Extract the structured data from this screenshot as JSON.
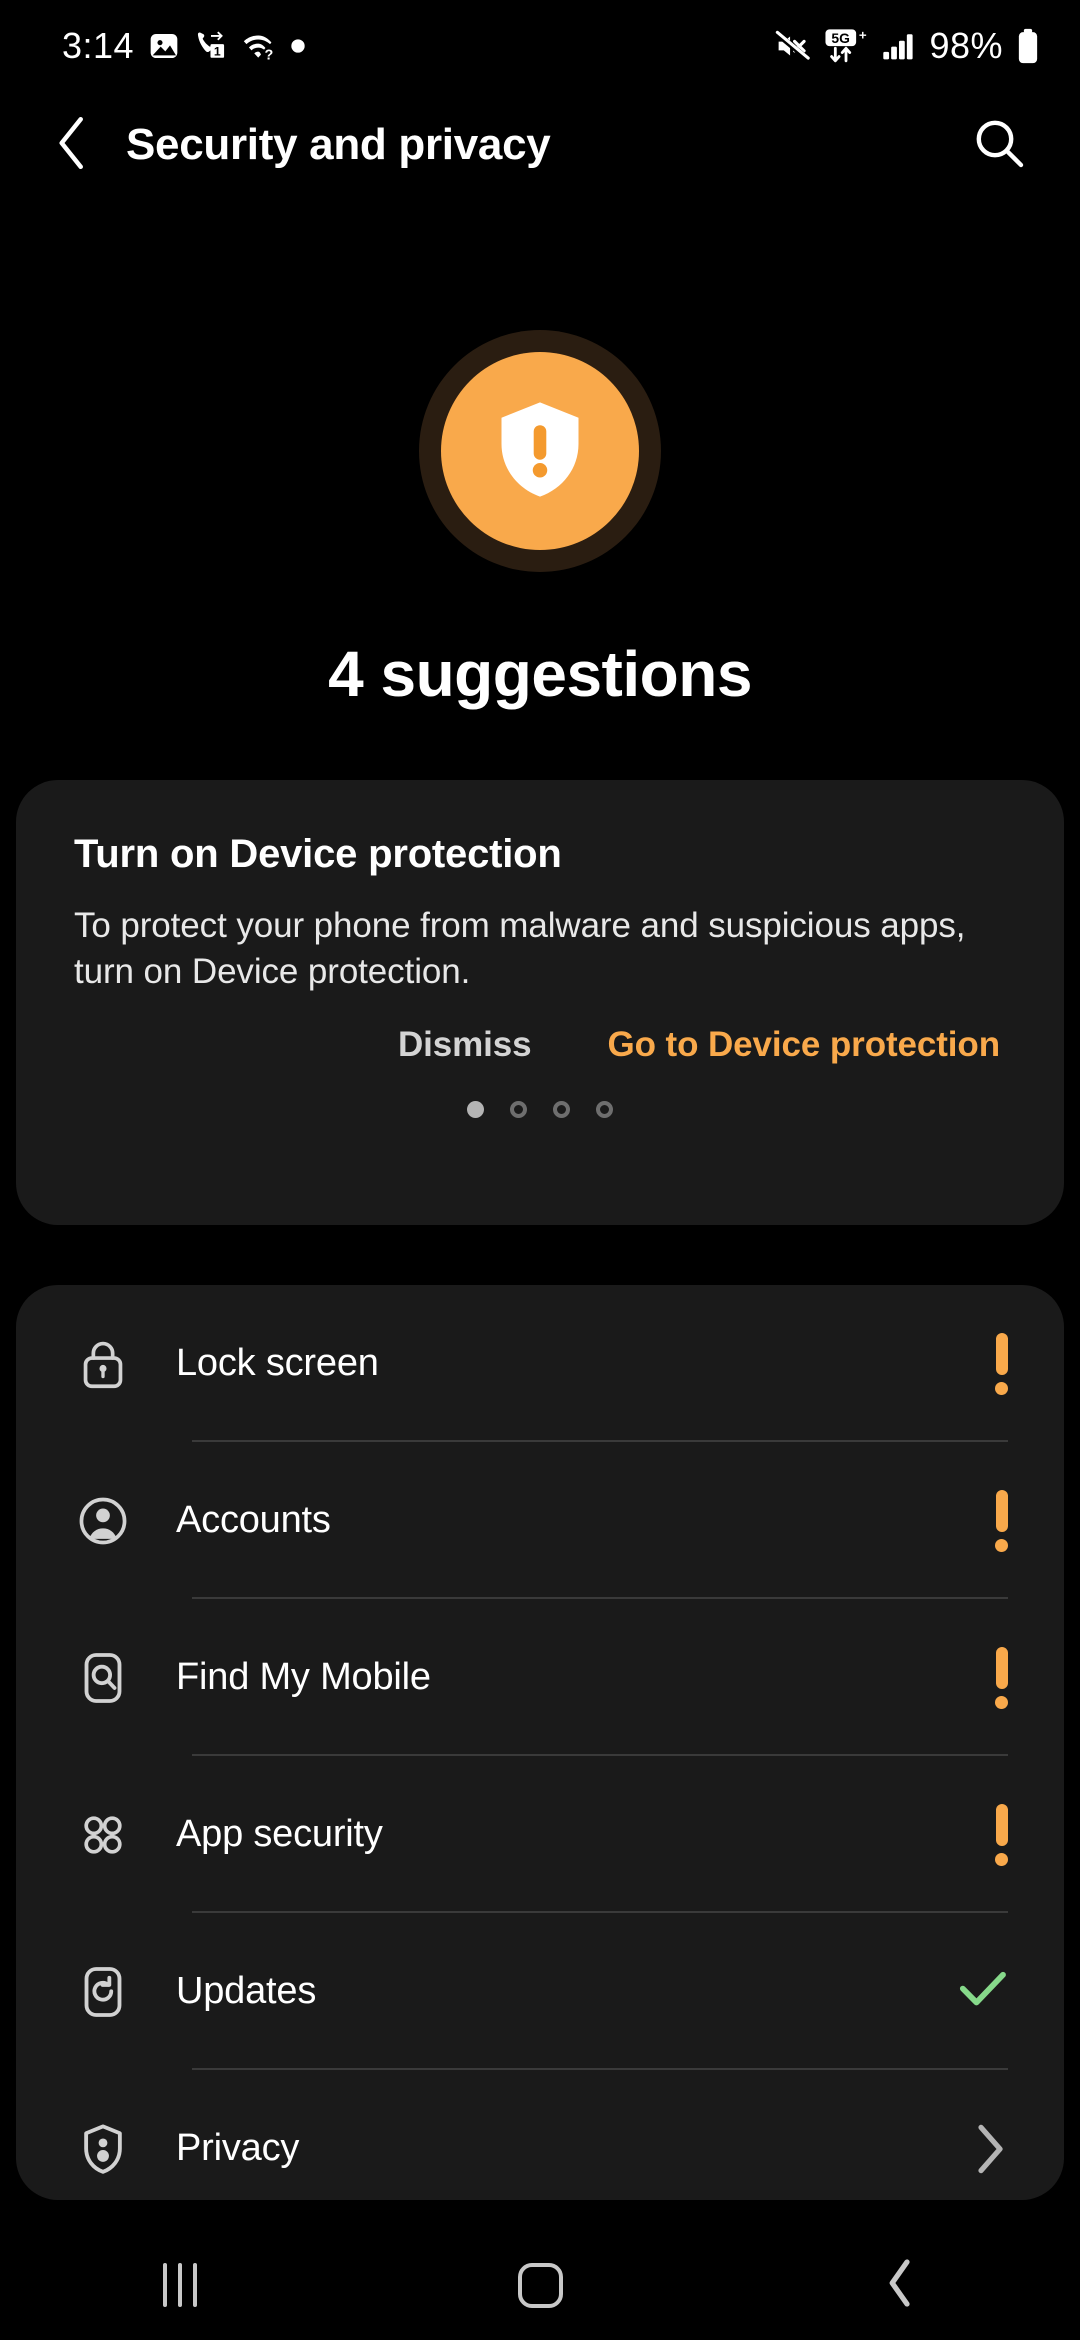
{
  "status_bar": {
    "time": "3:14",
    "left_icons": [
      "image-icon",
      "call-forwarding-sim1-icon",
      "wifi-question-icon",
      "dot-icon"
    ],
    "right_icons": [
      "mute-icon",
      "5g-plus-data-icon",
      "signal-bars-icon",
      "battery-icon"
    ],
    "network_label": "5G",
    "network_suffix": "+",
    "battery_percent": "98%"
  },
  "app_bar": {
    "back_icon": "chevron-left-icon",
    "title": "Security and privacy",
    "search_icon": "search-icon"
  },
  "hero": {
    "status_icon": "shield-exclamation-icon",
    "count_text": "4 suggestions",
    "accent_color": "#f9a94b",
    "ring_color": "#2a1d11"
  },
  "suggestion_card": {
    "title": "Turn on Device protection",
    "description": "To protect your phone from malware and suspicious apps, turn on Device protection.",
    "dismiss_label": "Dismiss",
    "primary_label": "Go to Device protection",
    "pager": {
      "total": 4,
      "active_index": 0
    }
  },
  "settings_list": {
    "items": [
      {
        "label": "Lock screen",
        "icon": "lock-icon",
        "status": "warning",
        "status_icon": "exclamation-icon"
      },
      {
        "label": "Accounts",
        "icon": "account-circle-icon",
        "status": "warning",
        "status_icon": "exclamation-icon"
      },
      {
        "label": "Find My Mobile",
        "icon": "phone-search-icon",
        "status": "warning",
        "status_icon": "exclamation-icon"
      },
      {
        "label": "App security",
        "icon": "apps-grid-icon",
        "status": "warning",
        "status_icon": "exclamation-icon"
      },
      {
        "label": "Updates",
        "icon": "phone-refresh-icon",
        "status": "ok",
        "status_icon": "check-icon"
      },
      {
        "label": "Privacy",
        "icon": "shield-person-icon",
        "status": "navigate",
        "status_icon": "chevron-right-icon"
      }
    ],
    "warning_color": "#f9a94b",
    "ok_color": "#86d98a"
  },
  "nav_bar": {
    "recents_label": "recents-icon",
    "home_label": "home-icon",
    "back_label": "back-icon"
  }
}
